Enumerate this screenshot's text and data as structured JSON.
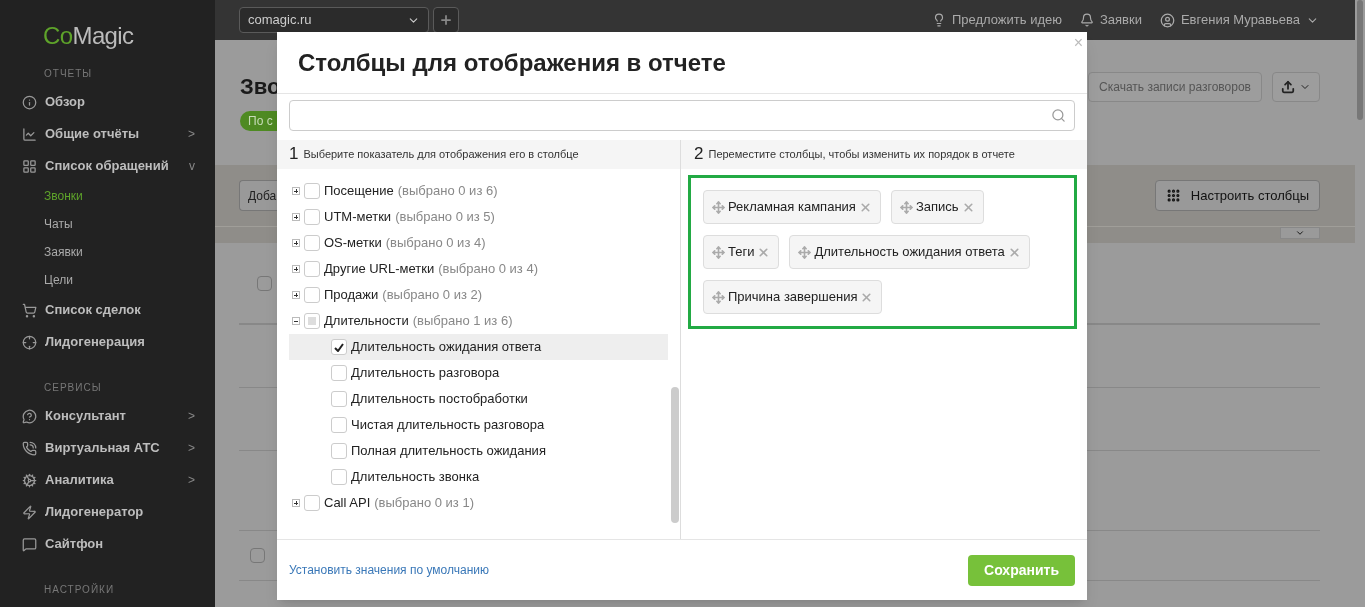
{
  "sidebar": {
    "logo_parts": [
      "Co",
      "Magic"
    ],
    "sections": [
      {
        "title": "ОТЧЕТЫ",
        "items": [
          {
            "label": "Обзор"
          },
          {
            "label": "Общие отчёты",
            "arrow": ">"
          },
          {
            "label": "Список обращений",
            "arrow": "v",
            "children": [
              {
                "label": "Звонки",
                "selected": true
              },
              {
                "label": "Чаты",
                "selected": false
              },
              {
                "label": "Заявки",
                "selected": false
              },
              {
                "label": "Цели",
                "selected": false
              }
            ]
          },
          {
            "label": "Список сделок"
          },
          {
            "label": "Лидогенерация"
          }
        ]
      },
      {
        "title": "СЕРВИСЫ",
        "items": [
          {
            "label": "Консультант",
            "arrow": ">"
          },
          {
            "label": "Виртуальная АТС",
            "arrow": ">"
          },
          {
            "label": "Аналитика",
            "arrow": ">"
          },
          {
            "label": "Лидогенератор"
          },
          {
            "label": "Сайтфон"
          }
        ]
      },
      {
        "title": "НАСТРОЙКИ"
      }
    ]
  },
  "topbar": {
    "site": "comagic.ru",
    "links": [
      "Предложить идею",
      "Заявки"
    ],
    "user": "Евгения Муравьева"
  },
  "page": {
    "title": "Зво",
    "pill": "По с",
    "download_button": "Скачать записи разговоров",
    "add_button": "Доба",
    "columns_button": "Настроить столбцы",
    "row_checkboxes": [
      {
        "checked": false
      },
      {
        "checked": false
      }
    ]
  },
  "modal": {
    "title": "Столбцы для отображения в отчете",
    "close": "×",
    "left_header": {
      "number": "1",
      "text": "Выберите показатель для отображения его в столбце"
    },
    "right_header": {
      "number": "2",
      "text": "Переместите столбцы, чтобы изменить их порядок в отчете"
    },
    "tree": [
      {
        "label": "Посещение",
        "count": "(выбрано 0 из 6)",
        "expanded": false,
        "partial": false
      },
      {
        "label": "UTM-метки",
        "count": "(выбрано 0 из 5)",
        "expanded": false,
        "partial": false
      },
      {
        "label": "OS-метки",
        "count": "(выбрано 0 из 4)",
        "expanded": false,
        "partial": false
      },
      {
        "label": "Другие URL-метки",
        "count": "(выбрано 0 из 4)",
        "expanded": false,
        "partial": false
      },
      {
        "label": "Продажи",
        "count": "(выбрано 0 из 2)",
        "expanded": false,
        "partial": false
      },
      {
        "label": "Длительности",
        "count": "(выбрано 1 из 6)",
        "expanded": true,
        "partial": true,
        "children": [
          {
            "label": "Длительность ожидания ответа",
            "checked": true,
            "selected": true
          },
          {
            "label": "Длительность разговора",
            "checked": false,
            "selected": false
          },
          {
            "label": "Длительность постобработки",
            "checked": false,
            "selected": false
          },
          {
            "label": "Чистая длительность разговора",
            "checked": false,
            "selected": false
          },
          {
            "label": "Полная длительность ожидания",
            "checked": false,
            "selected": false
          },
          {
            "label": "Длительность звонка",
            "checked": false,
            "selected": false
          }
        ]
      },
      {
        "label": "Call API",
        "count": "(выбрано 0 из 1)",
        "expanded": false,
        "partial": false
      }
    ],
    "chosen_columns": [
      "Рекламная кампания",
      "Запись",
      "Теги",
      "Длительность ожидания ответа",
      "Причина завершения"
    ],
    "reset_link": "Установить значения по умолчанию",
    "save_button": "Сохранить"
  }
}
